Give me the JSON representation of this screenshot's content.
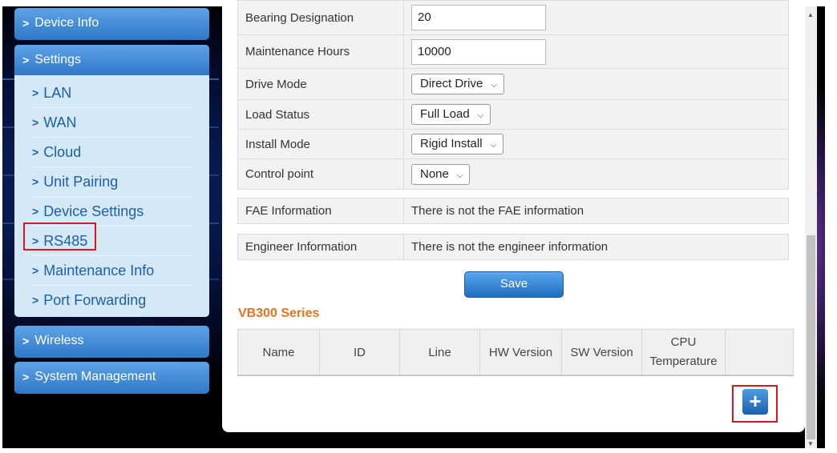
{
  "sidebar": {
    "device_info": "Device Info",
    "settings": "Settings",
    "settings_items": [
      "LAN",
      "WAN",
      "Cloud",
      "Unit Pairing",
      "Device Settings",
      "RS485",
      "Maintenance Info",
      "Port Forwarding"
    ],
    "wireless": "Wireless",
    "system_management": "System Management"
  },
  "form": {
    "bearing_designation": {
      "label": "Bearing Designation",
      "value": "20"
    },
    "maintenance_hours": {
      "label": "Maintenance Hours",
      "value": "10000"
    },
    "drive_mode": {
      "label": "Drive Mode",
      "value": "Direct Drive"
    },
    "load_status": {
      "label": "Load Status",
      "value": "Full Load"
    },
    "install_mode": {
      "label": "Install Mode",
      "value": "Rigid Install"
    },
    "control_point": {
      "label": "Control point",
      "value": "None"
    }
  },
  "fae": {
    "label": "FAE Information",
    "value": "There is not the FAE information"
  },
  "engineer": {
    "label": "Engineer Information",
    "value": "There is not the engineer information"
  },
  "save_label": "Save",
  "series": {
    "title": "VB300 Series",
    "columns": [
      "Name",
      "ID",
      "Line",
      "HW Version",
      "SW Version",
      "CPU Temperature",
      ""
    ]
  },
  "add_button_glyph": "+",
  "colors": {
    "accent_orange": "#e8731e",
    "nav_blue": "#2e78c6",
    "highlight_red": "#e0141e"
  }
}
